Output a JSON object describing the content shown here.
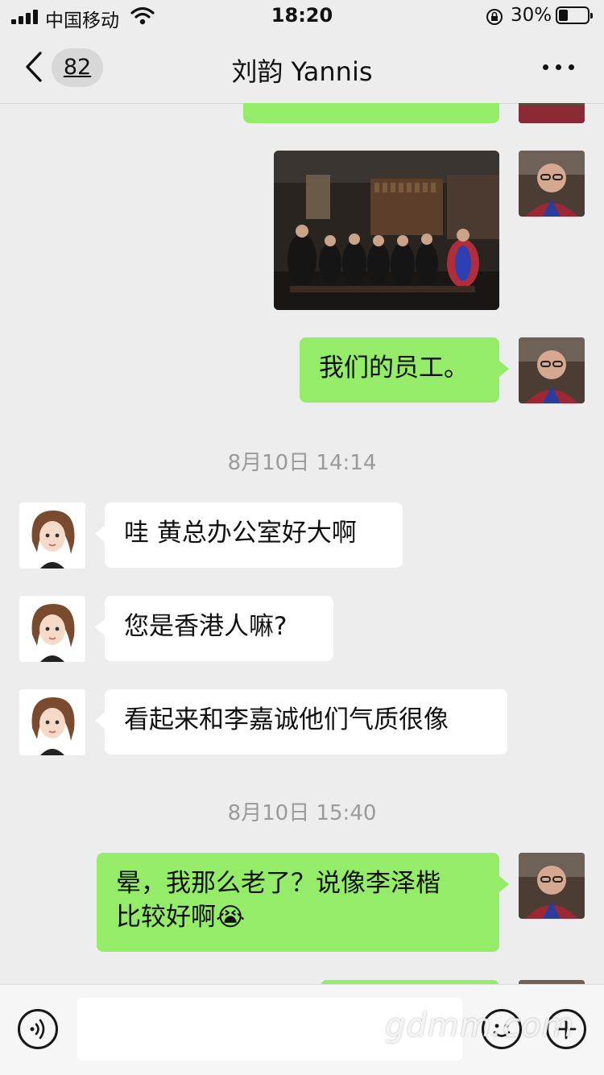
{
  "status_bar": {
    "carrier": "中国移动",
    "time": "18:20",
    "battery_percent": "30%",
    "icons": [
      "signal-icon",
      "wifi-icon",
      "orientation-lock-icon",
      "battery-icon"
    ]
  },
  "nav": {
    "back_icon": "chevron-left-icon",
    "unread_count": "82",
    "title": "刘韵 Yannis",
    "more_icon": "more-dots-icon"
  },
  "messages": [
    {
      "sender": "me",
      "type": "text",
      "text": ""
    },
    {
      "sender": "me",
      "type": "image",
      "description": "group-photo"
    },
    {
      "sender": "me",
      "type": "text",
      "text": "我们的员工。"
    },
    {
      "type": "timestamp",
      "text": "8月10日 14:14"
    },
    {
      "sender": "them",
      "type": "text",
      "text": "哇 黄总办公室好大啊"
    },
    {
      "sender": "them",
      "type": "text",
      "text": "您是香港人嘛?"
    },
    {
      "sender": "them",
      "type": "text",
      "text": "看起来和李嘉诚他们气质很像"
    },
    {
      "type": "timestamp",
      "text": "8月10日 15:40"
    },
    {
      "sender": "me",
      "type": "text",
      "text_line1": "晕，我那么老了？说像李泽楷",
      "text_line2": "比较好啊",
      "emoji": "😭"
    }
  ],
  "input_bar": {
    "voice_icon": "voice-icon",
    "emoji_icon": "emoji-icon",
    "plus_icon": "plus-icon",
    "value": "",
    "watermark": "gdmm.com"
  },
  "colors": {
    "background": "#ededed",
    "my_bubble": "#95ec69",
    "their_bubble": "#ffffff",
    "timestamp": "#9a9a9a"
  }
}
